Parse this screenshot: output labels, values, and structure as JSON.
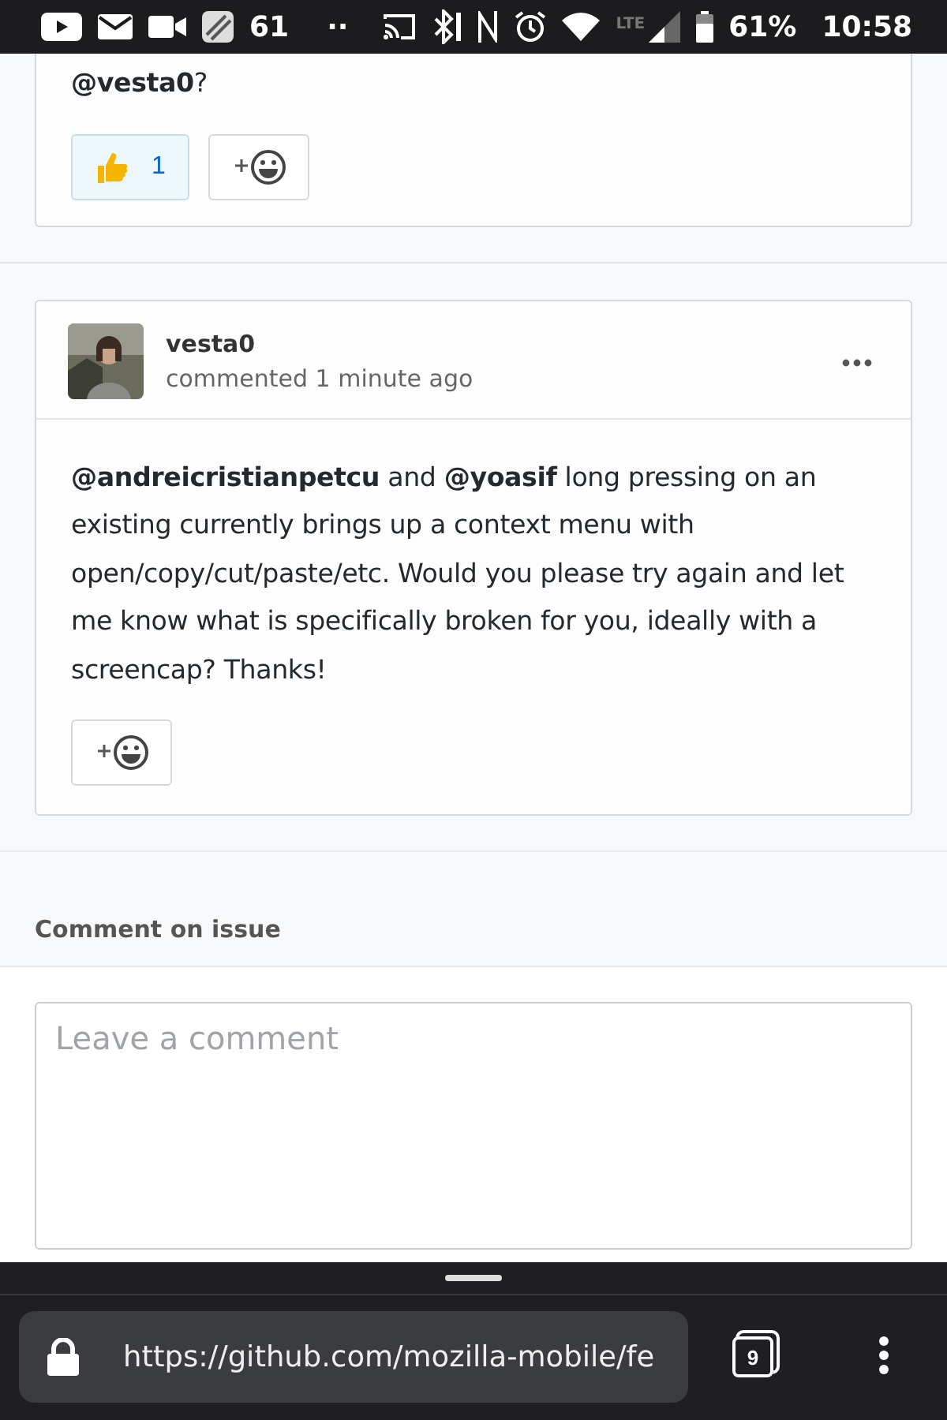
{
  "status_bar": {
    "notification_count": "61",
    "more": "··",
    "network": "LTE",
    "battery": "61%",
    "time": "10:58"
  },
  "previous_comment": {
    "text_tail": "**@vesta0**?",
    "reactions": [
      {
        "count": "1",
        "selected": true
      }
    ]
  },
  "comment": {
    "author": "vesta0",
    "meta": "commented 1 minute ago",
    "body": "**@andreicristianpetcu** and **@yoasif** long pressing on an existing currently brings up a context menu with open/copy/cut/paste/etc. Would you please try again and let me know what is specifically broken for you, ideally with a screencap? Thanks!"
  },
  "comment_form": {
    "heading": "Comment on issue",
    "placeholder": "Leave a comment"
  },
  "browser": {
    "url": "https://github.com/mozilla-mobile/fe",
    "tab_count": "9"
  }
}
